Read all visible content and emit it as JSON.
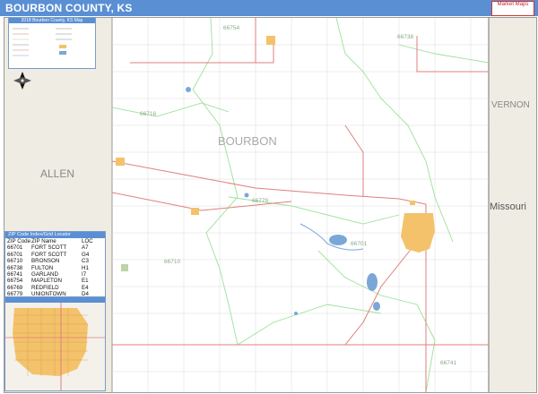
{
  "header": {
    "title": "BOURBON COUNTY, KS",
    "color": "#5a8fd3"
  },
  "logo": {
    "text": "Market Maps"
  },
  "legend": {
    "title": "2018 Bourbon County, KS Map"
  },
  "map": {
    "county_name": "BOURBON",
    "neighbors": {
      "west": "ALLEN",
      "east_county": "VERNON",
      "east_state": "Missouri"
    },
    "zip_labels": [
      "66754",
      "66738",
      "66716",
      "66779",
      "66701",
      "66710",
      "66741"
    ],
    "colors": {
      "land": "#f3f1ea",
      "county_area": "#ffffff",
      "zip_boundary": "#9ee09a",
      "highway": "#e07f7f",
      "city": "#f4c26a",
      "water": "#7aa7d8"
    }
  },
  "zip_index": {
    "title": "ZIP Code Index/Grid Locator",
    "headers": [
      "ZIP Code",
      "ZIP Name",
      "LOC"
    ],
    "rows": [
      [
        "66701",
        "FORT SCOTT",
        "A7"
      ],
      [
        "66701",
        "FORT SCOTT",
        "G4"
      ],
      [
        "66710",
        "BRONSON",
        "C3"
      ],
      [
        "66738",
        "FULTON",
        "H1"
      ],
      [
        "66741",
        "GARLAND",
        "I7"
      ],
      [
        "66754",
        "MAPLETON",
        "E1"
      ],
      [
        "66769",
        "REDFIELD",
        "E4"
      ],
      [
        "66779",
        "UNIONTOWN",
        "D4"
      ]
    ]
  }
}
